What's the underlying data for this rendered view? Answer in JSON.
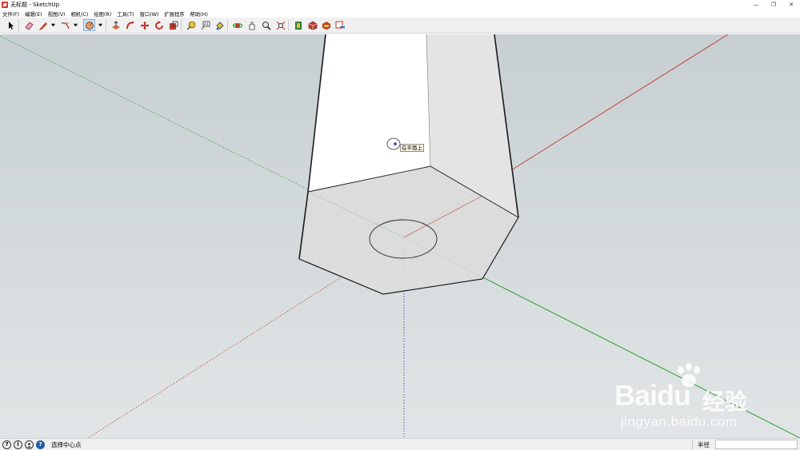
{
  "window": {
    "title": "无标题 - SketchUp",
    "controls": {
      "minimize": "—",
      "restore": "❐",
      "close": "✕"
    }
  },
  "menu": [
    "文件(F)",
    "编辑(E)",
    "视图(V)",
    "相机(C)",
    "绘图(R)",
    "工具(T)",
    "窗口(W)",
    "扩展程序",
    "帮助(H)"
  ],
  "toolbar": {
    "tools": [
      "select-arrow-icon",
      "eraser-icon",
      "pencil-line-icon",
      "arc-icon",
      "circle-icon",
      "push-pull-icon",
      "follow-me-icon",
      "move-icon",
      "rotate-icon",
      "scale-icon",
      "tape-measure-icon",
      "text-icon",
      "paint-bucket-icon",
      "orbit-icon",
      "pan-icon",
      "zoom-icon",
      "zoom-extents-icon",
      "3d-warehouse-icon",
      "extension-warehouse-icon",
      "layout-icon",
      "send-to-layout-icon"
    ],
    "active_tool": "circle-icon"
  },
  "viewport": {
    "inference_tooltip": "在平面上",
    "axis_colors": {
      "red": "#c0392b",
      "green": "#2e9c2e",
      "blue": "#2b3cc4"
    }
  },
  "watermark": {
    "logo": "Baidu",
    "cn": "经验",
    "url": "jingyan.baidu.com"
  },
  "status": {
    "message": "选择中心点",
    "measurement_label": "半径",
    "measurement_value": ""
  }
}
